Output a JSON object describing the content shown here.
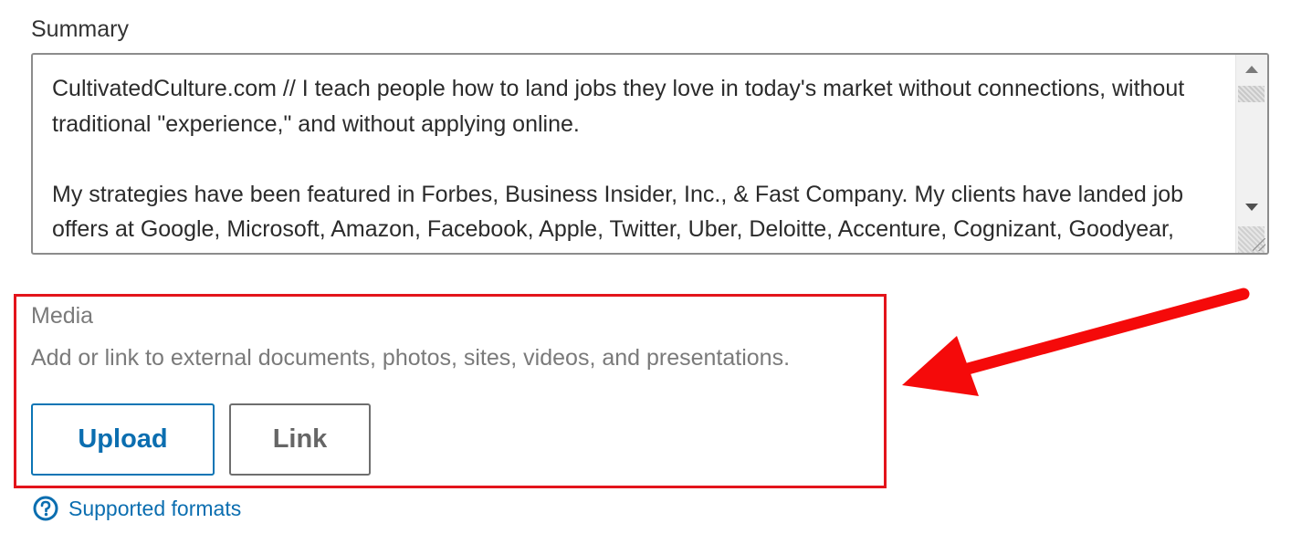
{
  "summary": {
    "label": "Summary",
    "value": "CultivatedCulture.com // I teach people how to land jobs they love in today's market without connections, without traditional \"experience,\" and without applying online.\n\nMy strategies have been featured in Forbes, Business Insider, Inc., & Fast Company. My clients have landed job offers at Google, Microsoft, Amazon, Facebook, Apple, Twitter, Uber, Deloitte, Accenture, Cognizant, Goodyear, ESPN & more."
  },
  "media": {
    "label": "Media",
    "description": "Add or link to external documents, photos, sites, videos, and presentations.",
    "upload_label": "Upload",
    "link_label": "Link"
  },
  "help": {
    "label": "Supported formats",
    "icon": "question-circle-icon"
  },
  "colors": {
    "accent": "#0b6eb0",
    "highlight": "#e3141b",
    "muted_text": "#7a7a7a"
  }
}
